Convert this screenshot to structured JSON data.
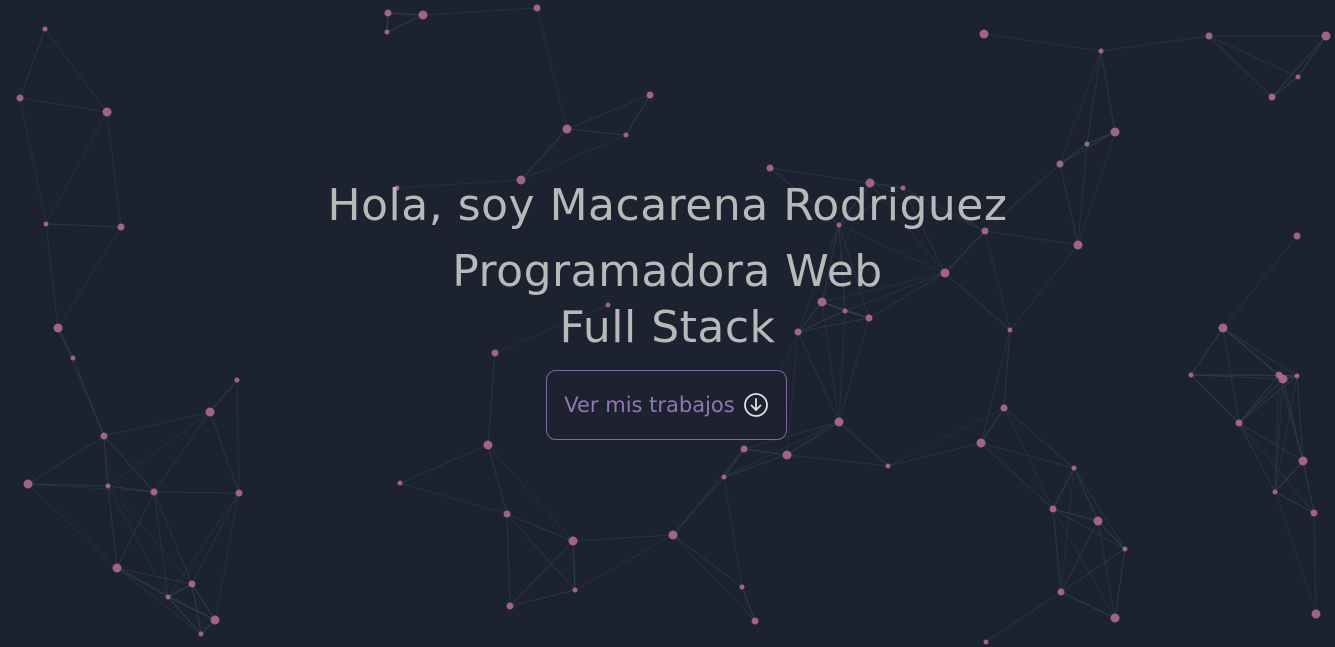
{
  "hero": {
    "greeting": "Hola, soy Macarena Rodriguez",
    "role_line_1": "Programadora Web",
    "role_line_2": "Full Stack",
    "cta_label": "Ver mis trabajos",
    "cta_icon": "arrow-down-circle-icon"
  },
  "colors": {
    "background": "#1d2230",
    "heading_text": "#b9b9b9",
    "cta_text": "#8f78b5",
    "cta_border": "#7c6a99",
    "node": "#b06a8e",
    "link": "#2f4a5a"
  }
}
